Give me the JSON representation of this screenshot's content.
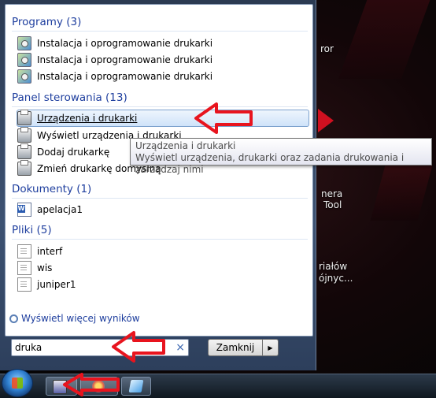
{
  "desktop": {
    "labels": [
      {
        "text": "ror"
      },
      {
        "text": "nera"
      },
      {
        "text": "Tool"
      },
      {
        "text": "riałów"
      },
      {
        "text": "ójnyc..."
      }
    ]
  },
  "groups": {
    "programs": {
      "header": "Programy (3)",
      "items": [
        {
          "label": "Instalacja i oprogramowanie drukarki",
          "icon": "install-icon"
        },
        {
          "label": "Instalacja i oprogramowanie drukarki",
          "icon": "install-icon"
        },
        {
          "label": "Instalacja i oprogramowanie drukarki",
          "icon": "install-icon"
        }
      ]
    },
    "control_panel": {
      "header": "Panel sterowania (13)",
      "items": [
        {
          "label": "Urządzenia i drukarki",
          "icon": "printer-icon",
          "selected": true
        },
        {
          "label": "Wyświetl urządzenia i drukarki",
          "icon": "printer-icon"
        },
        {
          "label": "Dodaj drukarkę",
          "icon": "printer-icon"
        },
        {
          "label": "Zmień drukarkę domyślną",
          "icon": "printer-icon"
        }
      ]
    },
    "documents": {
      "header": "Dokumenty (1)",
      "items": [
        {
          "label": "apelacja1",
          "icon": "word-document-icon"
        }
      ]
    },
    "files": {
      "header": "Pliki (5)",
      "items": [
        {
          "label": "interf",
          "icon": "file-icon"
        },
        {
          "label": "wis",
          "icon": "file-icon"
        },
        {
          "label": "juniper1",
          "icon": "file-icon"
        }
      ]
    }
  },
  "tooltip": {
    "title": "Urządzenia i drukarki",
    "description": "Wyświetl urządzenia, drukarki oraz zadania drukowania i zarządzaj nimi"
  },
  "more_results": "Wyświetl więcej wyników",
  "search": {
    "value": "druka",
    "clear_glyph": "×"
  },
  "shutdown": {
    "label": "Zamknij",
    "arrow": "▶"
  },
  "colors": {
    "header_blue": "#1e3e9e",
    "annotation_red": "#e8141e",
    "selection_border": "#7da2ce"
  }
}
